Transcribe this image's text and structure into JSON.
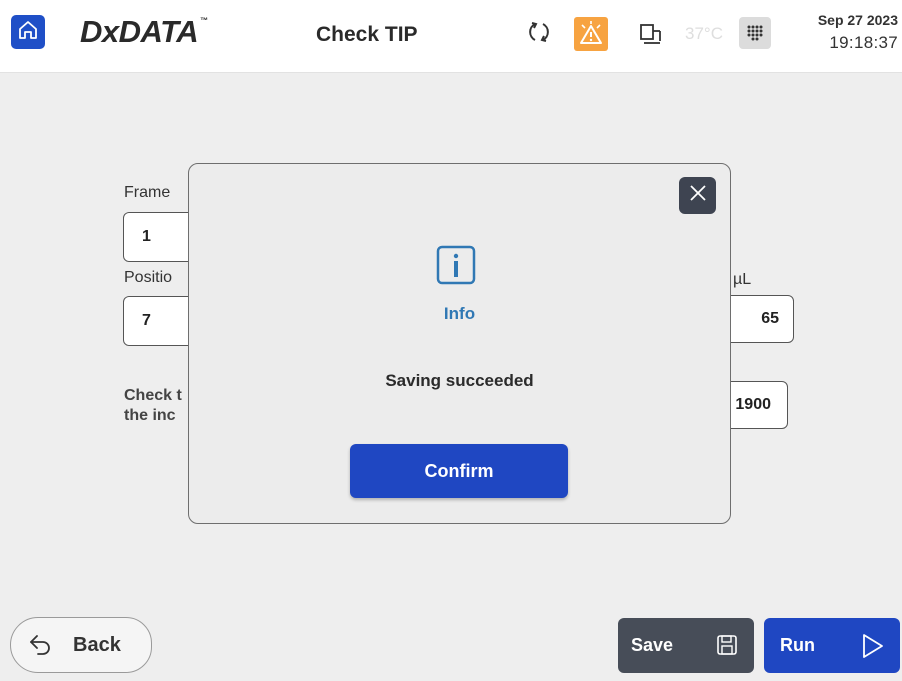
{
  "header": {
    "brand": "DxDATA",
    "brand_tm": "™",
    "title": "Check TIP",
    "temperature": "37°C",
    "date": "Sep 27 2023",
    "time": "19:18:37",
    "icons": [
      "home-icon",
      "sync-icon",
      "alarm-warning-icon",
      "device-icon",
      "keypad-icon"
    ],
    "alarm_color": "#f7a341"
  },
  "form": {
    "frame_label": "Frame",
    "frame_value": "1",
    "position_label": "Positio",
    "position_value": "7",
    "unit_label": "µL",
    "volume_value": "65",
    "third_value": "1900",
    "note_line1": "Check t",
    "note_line2": "the inc"
  },
  "modal": {
    "info_label": "Info",
    "message": "Saving succeeded",
    "confirm_label": "Confirm",
    "accent_color": "#3078b4"
  },
  "footer": {
    "back_label": "Back",
    "save_label": "Save",
    "run_label": "Run"
  },
  "colors": {
    "primary": "#1f47c2",
    "dark": "#474d58",
    "background": "#eeeeee"
  }
}
